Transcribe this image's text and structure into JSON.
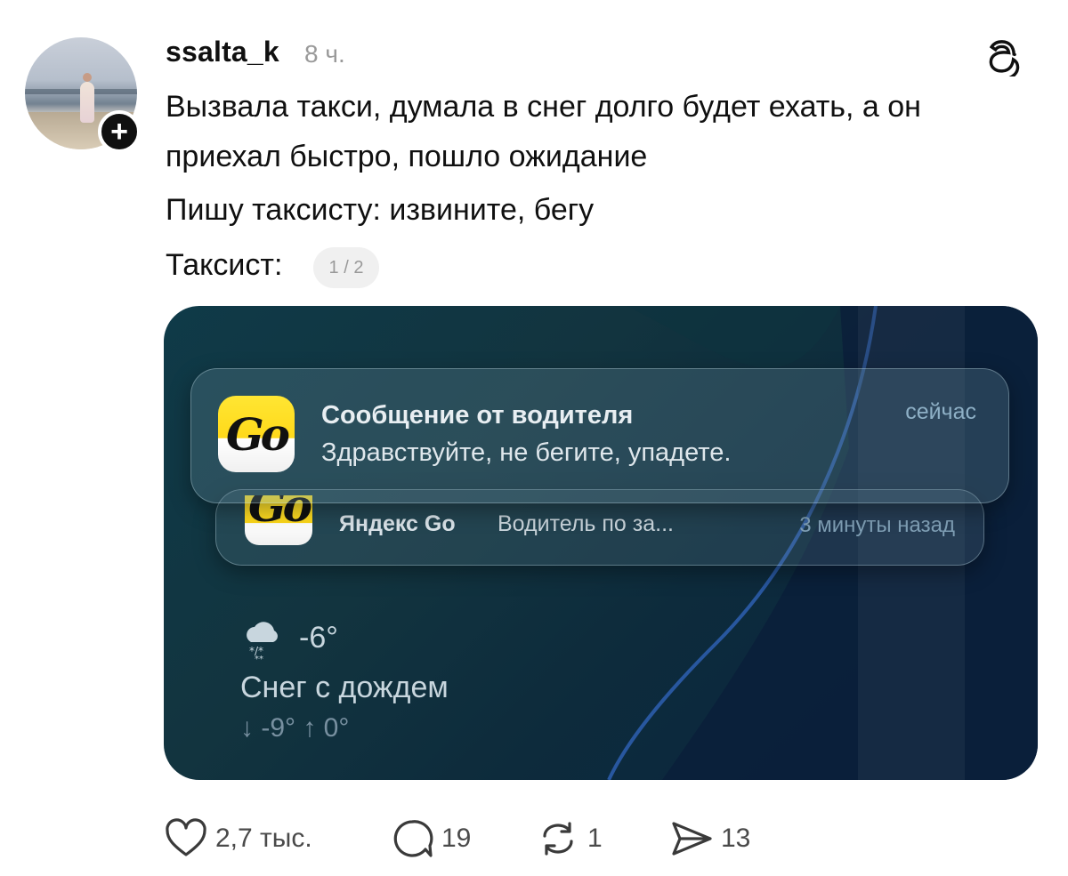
{
  "post": {
    "username": "ssalta_k",
    "time": "8 ч.",
    "lines": [
      "Вызвала такси, думала в снег долго будет ехать, а он",
      "приехал быстро, пошло ожидание",
      "Пишу таксисту: извините, бегу",
      "Таксист:"
    ],
    "media_counter": "1 / 2",
    "follow_symbol": "+"
  },
  "media": {
    "notification_main": {
      "app_icon_text": "Go",
      "title": "Сообщение от водителя",
      "body": "Здравствуйте, не бегите, упадете.",
      "time": "сейчас"
    },
    "notification_secondary": {
      "app_icon_text": "Go",
      "app_name": "Яндекс Go",
      "body": "Водитель по за...",
      "time": "3 минуты назад"
    },
    "weather": {
      "icon": "cloud-snow-rain-icon",
      "temperature": "-6°",
      "condition": "Снег с дождем",
      "range": "↓ -9° ↑ 0°"
    }
  },
  "actions": {
    "likes": "2,7 тыс.",
    "replies": "19",
    "reposts": "1",
    "shares": "13"
  },
  "colors": {
    "text": "#101010",
    "muted": "#9a9a9a",
    "accent_yellow": "#ffd91a"
  }
}
